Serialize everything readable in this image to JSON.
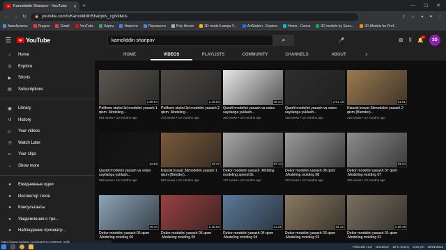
{
  "browser": {
    "tab_title": "Kamoliddin Sharipov - YouTube",
    "url": "youtube.com/c/KamoliddinSharipov_cg/videos",
    "bookmarks": [
      "Авиабилеты",
      "Яндекс",
      "Gmail",
      "YouTube",
      "Карты",
      "Новости",
      "Перевести",
      "Poly Haven",
      "3D model Lampa V...",
      "ArtStation - Explore",
      "Home - Canva",
      "3D models by Sune...",
      "3D Models for Prof..."
    ],
    "status_url": "https://www.youtube.com/watch?v=tyDKQZ_wcfk"
  },
  "header": {
    "logo": "YouTube",
    "search_value": "kamoliddin sharipov",
    "notification_count": "9+",
    "avatar_initials": "3D"
  },
  "sidebar": {
    "items": [
      {
        "icon": "home-icon",
        "label": "Home"
      },
      {
        "icon": "compass-icon",
        "label": "Explore"
      },
      {
        "icon": "shorts-icon",
        "label": "Shorts"
      },
      {
        "icon": "subscriptions-icon",
        "label": "Subscriptions"
      },
      {
        "icon": "library-icon",
        "label": "Library"
      },
      {
        "icon": "history-icon",
        "label": "History"
      },
      {
        "icon": "play-icon",
        "label": "Your videos"
      },
      {
        "icon": "clock-icon",
        "label": "Watch Later"
      },
      {
        "icon": "scissors-icon",
        "label": "Your clips"
      },
      {
        "icon": "chevron-down-icon",
        "label": "Show more"
      },
      {
        "icon": "channel-icon",
        "label": "Ежедневные идеи"
      },
      {
        "icon": "channel-icon",
        "label": "Инспектор тегов"
      },
      {
        "icon": "channel-icon",
        "label": "Консультанты"
      },
      {
        "icon": "channel-icon",
        "label": "Уведомления о тре..."
      },
      {
        "icon": "channel-icon",
        "label": "Наблюдение просматр..."
      }
    ]
  },
  "channel_tabs": [
    "HOME",
    "VIDEOS",
    "PLAYLISTS",
    "COMMUNITY",
    "CHANNELS",
    "ABOUT"
  ],
  "videos": [
    {
      "title": "Poliform stulini 3d modelini yasash 1 qism. Modeling...",
      "meta": "984 views • 10 months ago",
      "duration": "1:55:54",
      "bg": "#5a5550"
    },
    {
      "title": "Poliform stulini 3d modelini yasash 2 qism. Modeling...",
      "meta": "276 views • 10 months ago",
      "duration": "1:19:53",
      "bg": "#4f4b47"
    },
    {
      "title": "Qandil modelini yasash va sotuv saytlariga yuklash...",
      "meta": "260 views • 10 months ago",
      "duration": "48:34",
      "bg": "#e6e6e6"
    },
    {
      "title": "Qandil modelini yasash va sotuv saytlariga yuklash...",
      "meta": "156 views • 10 months ago",
      "duration": "2:01:19",
      "bg": "#2e2e2e"
    },
    {
      "title": "Klassik kravat 3dmodelini yasash 2 qism (Blender)...",
      "meta": "228 views • 10 months ago",
      "duration": "51:51",
      "bg": "#9b7a50"
    },
    {
      "title": "Qandil modelini yasash va sotuv saytlariga yuklash...",
      "meta": "599 views • 10 months ago",
      "duration": "32:03",
      "bg": "#111111"
    },
    {
      "title": "Klassik kravat 3dmodelini yasash 1 qism (Blender)...",
      "meta": "553 views • 10 months ago",
      "duration": "22:37",
      "bg": "#7a5a3a"
    },
    {
      "title": "Dekor modelini yasash .Molding modeling speed 8x.",
      "meta": "197 views • 10 months ago",
      "duration": "57:44",
      "bg": "#a8a8a8"
    },
    {
      "title": "Dekor modelini yasash 08 qism .Modeling molding 08",
      "meta": "223 views • 10 months ago",
      "duration": "",
      "bg": "#9a9a9a"
    },
    {
      "title": "Dekor modelini yasash 07 qism .Modeling molding 07",
      "meta": "286 views • 10 months ago",
      "duration": "33:24",
      "bg": "#8c8c8c"
    },
    {
      "title": "Dekor modelini yasash 06 qism .Modeling molding 06",
      "meta": "",
      "duration": "49:34",
      "bg": "#8aa4b8"
    },
    {
      "title": "Dekor modelini yasash 05 qism .Modeling molding 05",
      "meta": "",
      "duration": "1:18:53",
      "bg": "#9a4040"
    },
    {
      "title": "Dekor modelini yasash 04 qism .Modeling molding 04",
      "meta": "",
      "duration": "41:26",
      "bg": "#5a7a9a"
    },
    {
      "title": "Dekor modelini yasash 03 qism .Modeling molding 03",
      "meta": "",
      "duration": "54:32",
      "bg": "#8a7a60"
    },
    {
      "title": "Dekor modelini yasash 01 qism .Modeling molding 01",
      "meta": "",
      "duration": "1:26:49",
      "bg": "#7a7060"
    }
  ],
  "taskbar": {
    "desktop_label": "Рабочий стол",
    "onedrive": "OneDrive",
    "weather": "15°C Sunny",
    "time": "3:34 pm",
    "date": "30/01/2022"
  }
}
